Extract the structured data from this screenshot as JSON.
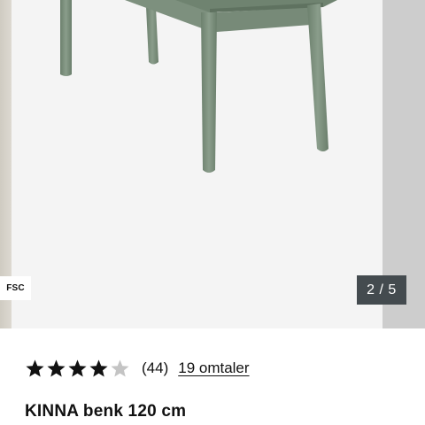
{
  "gallery": {
    "product_image_alt": "KINNA benk 120 cm",
    "fsc_badge": "FSC",
    "counter": "2 / 5",
    "colors": {
      "background": "#f4f4f4",
      "product_green": "#7b8f7c",
      "counter_bg": "#444b4f"
    }
  },
  "rating": {
    "stars_filled": 4,
    "stars_total": 5,
    "count_text": "(44)",
    "reviews_link": "19 omtaler",
    "star_color": "#111111",
    "star_empty_color": "#c4c4c4"
  },
  "product": {
    "title": "KINNA benk 120 cm"
  }
}
